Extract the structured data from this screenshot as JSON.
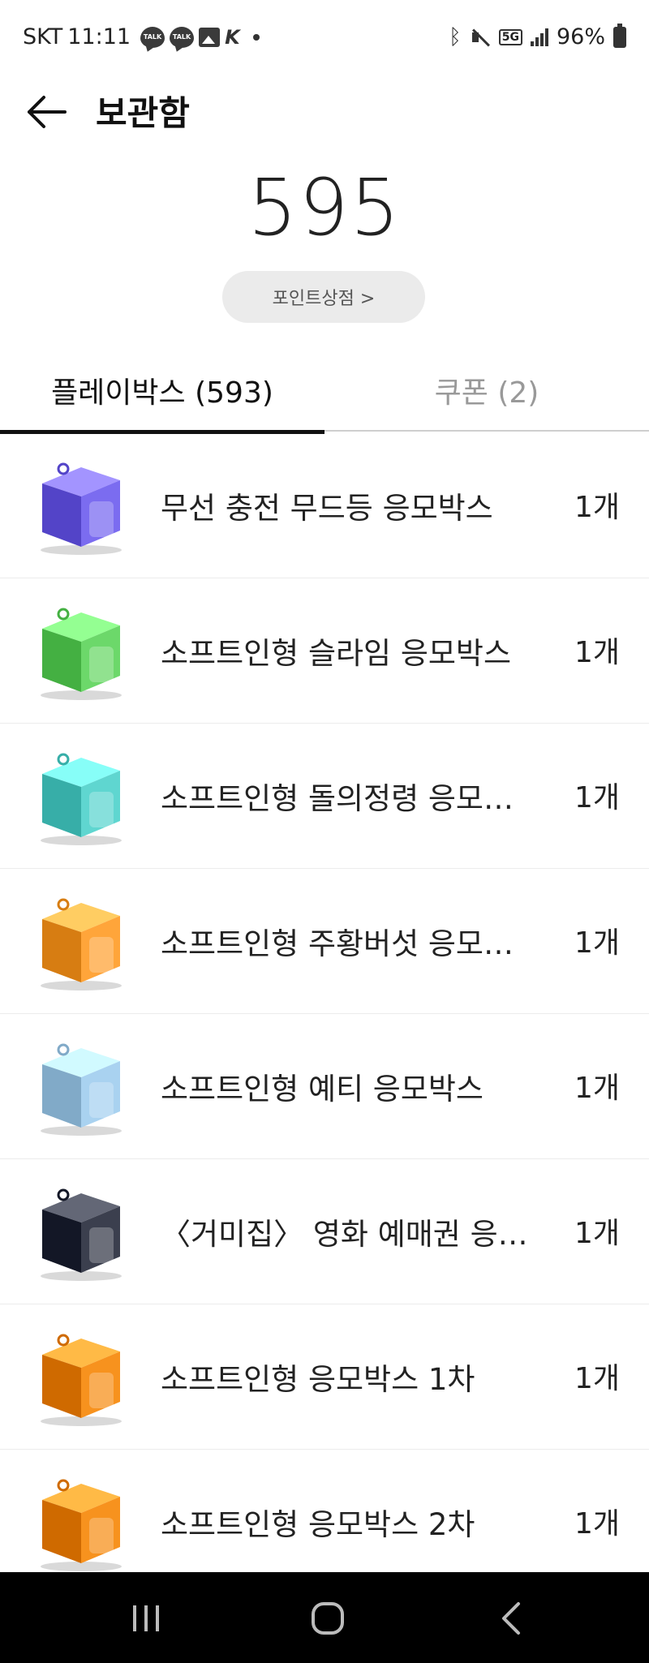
{
  "status_bar": {
    "carrier": "SKT",
    "time": "11:11",
    "talk_badge": "TALK",
    "network": "5G",
    "battery": "96%"
  },
  "header": {
    "title": "보관함"
  },
  "points": {
    "value": "595",
    "shop_button_label": "포인트상점 >"
  },
  "tabs": [
    {
      "label": "플레이박스 (593)",
      "active": true
    },
    {
      "label": "쿠폰 (2)",
      "active": false
    }
  ],
  "items": [
    {
      "name": "무선 충전 무드등 응모박스",
      "qty": "1개",
      "color": "#7b6cf0",
      "icon": "nexon-purple-box"
    },
    {
      "name": "소프트인형 슬라임 응모박스",
      "qty": "1개",
      "color": "#6cd86a",
      "icon": "slime-green-box"
    },
    {
      "name": "소프트인형 돌의정령 응모…",
      "qty": "1개",
      "color": "#5fd6d0",
      "icon": "stone-spirit-teal-box"
    },
    {
      "name": "소프트인형 주황버섯 응모…",
      "qty": "1개",
      "color": "#ffa53a",
      "icon": "orange-mushroom-box"
    },
    {
      "name": "소프트인형 예티 응모박스",
      "qty": "1개",
      "color": "#a9d2f0",
      "icon": "yeti-blue-box"
    },
    {
      "name": "〈거미집〉 영화 예매권 응…",
      "qty": "1개",
      "color": "#3b3f4e",
      "icon": "movie-ticket-dark-box"
    },
    {
      "name": "소프트인형 응모박스 1차",
      "qty": "1개",
      "color": "#f7921e",
      "icon": "maple-orange-box"
    },
    {
      "name": "소프트인형 응모박스 2차",
      "qty": "1개",
      "color": "#f7921e",
      "icon": "maple-orange-box"
    }
  ]
}
